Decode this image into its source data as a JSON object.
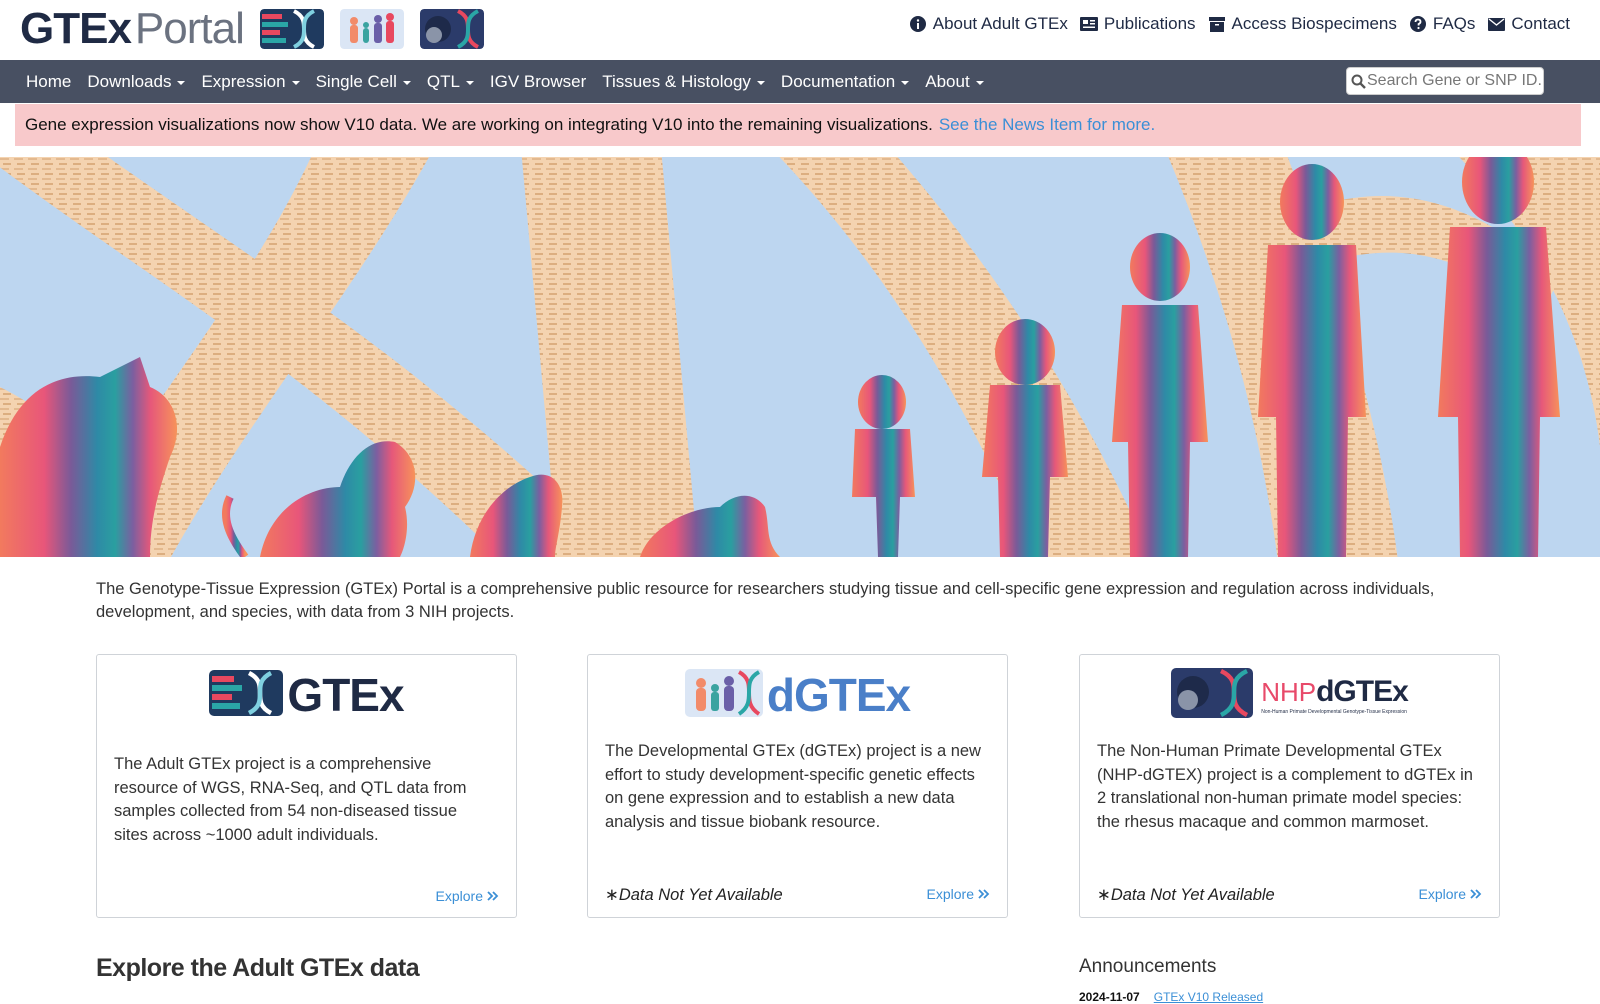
{
  "header": {
    "brand_primary": "GTEx",
    "brand_secondary": "Portal",
    "links": [
      {
        "label": "About Adult GTEx",
        "icon": "info-circle-icon"
      },
      {
        "label": "Publications",
        "icon": "newspaper-icon"
      },
      {
        "label": "Access Biospecimens",
        "icon": "archive-icon"
      },
      {
        "label": "FAQs",
        "icon": "question-circle-icon"
      },
      {
        "label": "Contact",
        "icon": "envelope-icon"
      }
    ]
  },
  "nav": {
    "items": [
      {
        "label": "Home",
        "dropdown": false
      },
      {
        "label": "Downloads",
        "dropdown": true
      },
      {
        "label": "Expression",
        "dropdown": true
      },
      {
        "label": "Single Cell",
        "dropdown": true
      },
      {
        "label": "QTL",
        "dropdown": true
      },
      {
        "label": "IGV Browser",
        "dropdown": false
      },
      {
        "label": "Tissues & Histology",
        "dropdown": true
      },
      {
        "label": "Documentation",
        "dropdown": true
      },
      {
        "label": "About",
        "dropdown": true
      }
    ],
    "search_placeholder": "Search Gene or SNP ID..."
  },
  "alert": {
    "message": "Gene expression visualizations now show V10 data. We are working on integrating V10 into the remaining visualizations.",
    "link_text": "See the News Item for more."
  },
  "intro": {
    "text": "The Genotype-Tissue Expression (GTEx) Portal is a comprehensive public resource for researchers studying tissue and cell-specific gene expression and regulation across individuals, development, and species, with data from 3 NIH projects."
  },
  "cards": [
    {
      "logo_text": "GTEx",
      "description": "The Adult GTEx project is a comprehensive resource of WGS, RNA-Seq, and QTL data from samples collected from 54 non-diseased tissue sites across ~1000 adult individuals.",
      "note": "",
      "explore_label": "Explore"
    },
    {
      "logo_text": "dGTEx",
      "description": "The Developmental GTEx (dGTEx) project is a new effort to study development-specific genetic effects on gene expression and to establish a new data analysis and tissue biobank resource.",
      "note": "∗Data Not Yet Available",
      "explore_label": "Explore"
    },
    {
      "logo_prefix": "NHP",
      "logo_text": "dGTEx",
      "logo_subtitle": "Non-Human Primate Developmental Genotype-Tissue Expression",
      "description": "The Non-Human Primate Developmental GTEx (NHP-dGTEX) project is a complement to dGTEx in 2 translational non-human primate model species: the rhesus macaque and common marmoset.",
      "note": "∗Data Not Yet Available",
      "explore_label": "Explore"
    }
  ],
  "explore_section": {
    "title": "Explore the Adult GTEx data"
  },
  "announcements": {
    "title": "Announcements",
    "items": [
      {
        "date": "2024-11-07",
        "label": "GTEx V10 Released"
      }
    ]
  },
  "colors": {
    "navbar": "#485062",
    "alert_bg": "#f8c9cb",
    "link": "#3b8fd6",
    "brand_dark": "#1f2a44",
    "dgtex_blue": "#4a7fc8",
    "nhp_pink": "#e84a6a"
  }
}
